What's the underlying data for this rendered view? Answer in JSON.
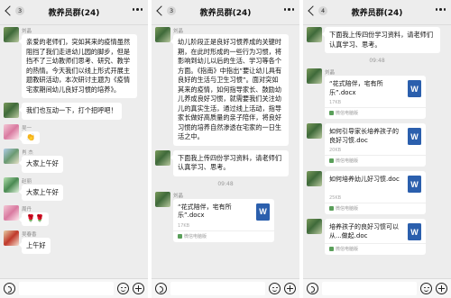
{
  "panels": [
    {
      "header": {
        "back_count": "3",
        "title": "教养员群(24)"
      },
      "messages": [
        {
          "kind": "text",
          "sender": "刘晶",
          "avatar": "g1",
          "text": "亲爱的老师们，突如其来的疫情虽然阻挡了我们走进幼儿园的脚步，但是挡不了三幼教师们思考、研究、教学的热情。今天我们以线上形式开展主题教研活动，本次研讨主题为《疫情宅家期间幼儿良好习惯的培养》。"
        },
        {
          "kind": "text",
          "sender": "",
          "avatar": "g1",
          "text": "我们也互动一下，打个招呼吧！"
        },
        {
          "kind": "emoji",
          "sender": "吴一",
          "avatar": "g3",
          "text": "👏"
        },
        {
          "kind": "text",
          "sender": "肖 杰",
          "avatar": "g2",
          "text": "大家上午好"
        },
        {
          "kind": "text",
          "sender": "赵丽",
          "avatar": "g4",
          "text": "大家上午好"
        },
        {
          "kind": "emoji",
          "sender": "周丹",
          "avatar": "g3",
          "text": "🌹🌹"
        },
        {
          "kind": "text",
          "sender": "吴春香",
          "avatar": "g6",
          "text": "上午好"
        }
      ]
    },
    {
      "header": {
        "back_count": "3",
        "title": "教养员群(24)"
      },
      "messages": [
        {
          "kind": "text",
          "sender": "刘晶",
          "avatar": "g1",
          "text": "幼儿阶段正是良好习惯养成的关键时期，在此时形成的一些行为习惯，将影响到幼儿以后的生活、学习等各个方面。《指南》中指出”要让幼儿具有良好的生活与卫生习惯”。面对突如其来的疫情，如何指导家长、鼓励幼儿养成良好习惯，就需要我们关注幼儿的真实生活，通过线上活动，指导家长做好高质量的亲子陪伴，将良好习惯的培养自然渗透在宅家的一日生活之中。"
        },
        {
          "kind": "text",
          "sender": "",
          "avatar": "g1",
          "text": "下面我上传四份学习资料，请老师们认真学习、思考。"
        },
        {
          "kind": "time",
          "text": "09:48"
        },
        {
          "kind": "file",
          "sender": "刘晶",
          "avatar": "g1",
          "name": "“花式陪伴，宅有所乐”.docx",
          "size": "17KB",
          "source": "微信电脑版"
        }
      ]
    },
    {
      "header": {
        "back_count": "4",
        "title": "教养员群(24)"
      },
      "messages": [
        {
          "kind": "text",
          "sender": "",
          "avatar": "g1",
          "text": "下面我上传四份学习资料，请老师们认真学习、思考。"
        },
        {
          "kind": "time",
          "text": "09:48"
        },
        {
          "kind": "file",
          "sender": "刘晶",
          "avatar": "g1",
          "name": "“花式陪伴，宅有所乐”.docx",
          "size": "17KB",
          "source": "微信电脑版"
        },
        {
          "kind": "file",
          "sender": "刘晶",
          "avatar": "g1",
          "name": "如何引导家长培养孩子的良好习惯.doc",
          "size": "20KB",
          "source": "微信电脑版"
        },
        {
          "kind": "file",
          "sender": "刘晶",
          "avatar": "g1",
          "name": "如何培养幼儿好习惯.doc",
          "size": "25KB",
          "source": "微信电脑版"
        },
        {
          "kind": "file",
          "sender": "刘晶",
          "avatar": "g1",
          "name": "培养孩子的良好习惯可以从...做起.doc",
          "size": "",
          "source": "微信电脑版"
        }
      ]
    }
  ],
  "icons": {
    "file": "word-doc-icon",
    "word_letter": "W"
  }
}
